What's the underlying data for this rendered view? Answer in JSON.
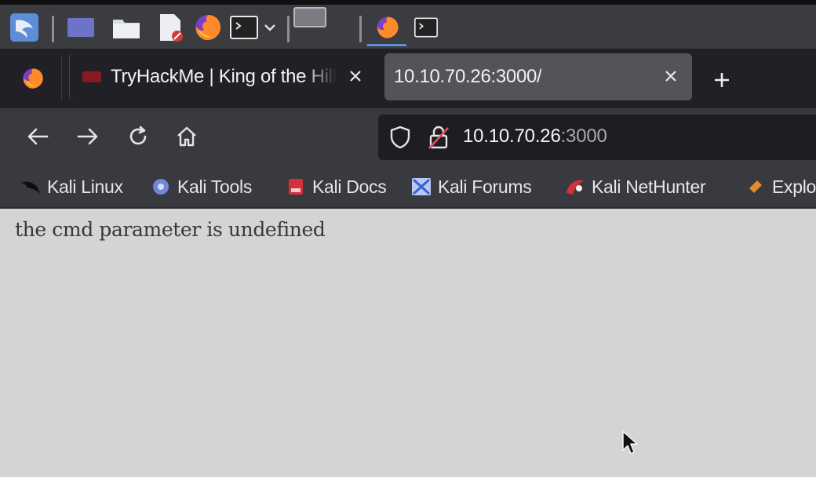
{
  "panel": {
    "icons": [
      "kali-menu-icon",
      "workspace-icon",
      "file-manager-icon",
      "text-editor-icon",
      "firefox-icon",
      "terminal-icon",
      "dropdown-icon",
      "window-icon",
      "firefox-task-icon",
      "terminal-task-icon"
    ]
  },
  "tabs": [
    {
      "title": "TryHackMe | King of the Hill",
      "active": false
    },
    {
      "title": "10.10.70.26:3000/",
      "active": true
    }
  ],
  "navbar": {
    "url_host": "10.10.70.26",
    "url_port": ":3000"
  },
  "bookmarks": [
    {
      "label": "Kali Linux",
      "icon": "kali-dragon-icon"
    },
    {
      "label": "Kali Tools",
      "icon": "kali-tools-icon"
    },
    {
      "label": "Kali Docs",
      "icon": "kali-docs-icon"
    },
    {
      "label": "Kali Forums",
      "icon": "kali-forums-icon"
    },
    {
      "label": "Kali NetHunter",
      "icon": "kali-nethunter-icon"
    },
    {
      "label": "Exploit-DB",
      "icon": "exploit-db-icon"
    }
  ],
  "page": {
    "body_text": "the cmd parameter is undefined"
  },
  "colors": {
    "panel_bg": "#3b3c40",
    "tabstrip_bg": "#202026",
    "active_tab_bg": "#53545a",
    "toolbar_bg": "#393a40",
    "urlbar_bg": "#1d1d22",
    "page_bg": "#d4d4d4",
    "accent_blue": "#5d8fd8",
    "insecure_red": "#e8505b"
  }
}
